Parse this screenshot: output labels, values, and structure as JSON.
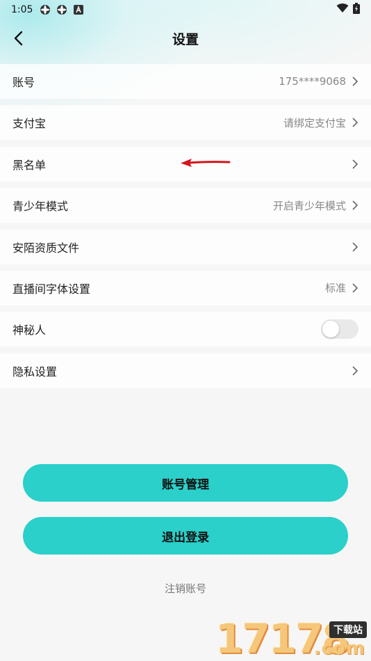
{
  "status_bar": {
    "time": "1:05",
    "left_icons": [
      "settings-gear-icon",
      "settings-gear-icon",
      "font-a-icon"
    ],
    "right_icons": [
      "wifi-icon",
      "battery-charging-icon"
    ]
  },
  "header": {
    "title": "设置",
    "back_icon": "chevron-left-icon"
  },
  "settings": [
    {
      "label": "账号",
      "value": "175****9068",
      "type": "link"
    },
    {
      "label": "支付宝",
      "value": "请绑定支付宝",
      "type": "link"
    },
    {
      "label": "黑名单",
      "value": "",
      "type": "link"
    },
    {
      "label": "青少年模式",
      "value": "开启青少年模式",
      "type": "link"
    },
    {
      "label": "安陌资质文件",
      "value": "",
      "type": "link"
    },
    {
      "label": "直播间字体设置",
      "value": "标准",
      "type": "link"
    },
    {
      "label": "神秘人",
      "value": "",
      "type": "toggle",
      "enabled": false
    },
    {
      "label": "隐私设置",
      "value": "",
      "type": "link"
    }
  ],
  "actions": {
    "account_manage": "账号管理",
    "logout": "退出登录",
    "cancel_account": "注销账号"
  },
  "annotation": {
    "arrow_color": "#d4141c"
  },
  "watermark": {
    "digits": "17178",
    "badge": "下载站",
    "suffix": ".com"
  },
  "colors": {
    "accent": "#2ad0c9",
    "background": "#f6f6f6"
  }
}
